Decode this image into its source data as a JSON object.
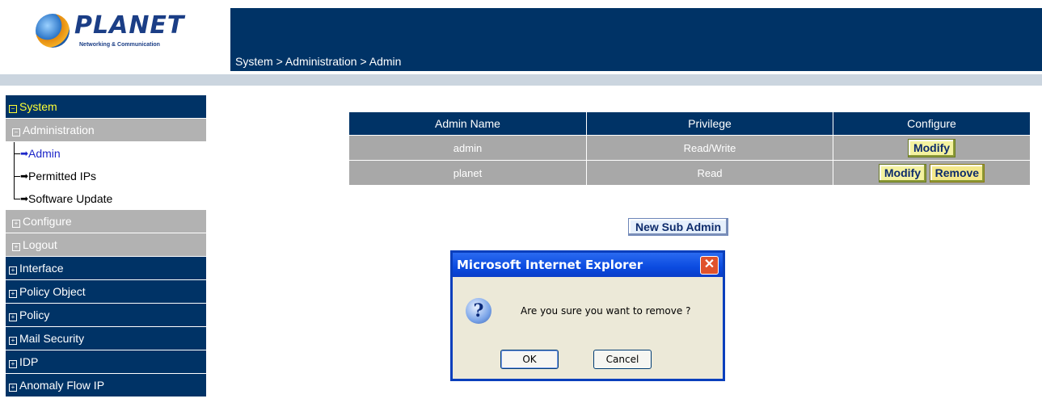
{
  "logo": {
    "name": "PLANET",
    "tagline": "Networking & Communication"
  },
  "breadcrumb": "System > Administration > Admin",
  "sidebar": {
    "system": "System",
    "administration": "Administration",
    "sub_items": [
      "Admin",
      "Permitted IPs",
      "Software Update"
    ],
    "configure": "Configure",
    "logout": "Logout",
    "sections": [
      "Interface",
      "Policy Object",
      "Policy",
      "Mail Security",
      "IDP",
      "Anomaly Flow IP"
    ]
  },
  "table": {
    "headers": [
      "Admin Name",
      "Privilege",
      "Configure"
    ],
    "rows": [
      {
        "name": "admin",
        "privilege": "Read/Write"
      },
      {
        "name": "planet",
        "privilege": "Read"
      }
    ],
    "modify_label": "Modify",
    "remove_label": "Remove"
  },
  "new_sub_admin_label": "New Sub Admin",
  "dialog": {
    "title": "Microsoft Internet Explorer",
    "message": "Are you sure you want to remove ?",
    "ok": "OK",
    "cancel": "Cancel"
  }
}
